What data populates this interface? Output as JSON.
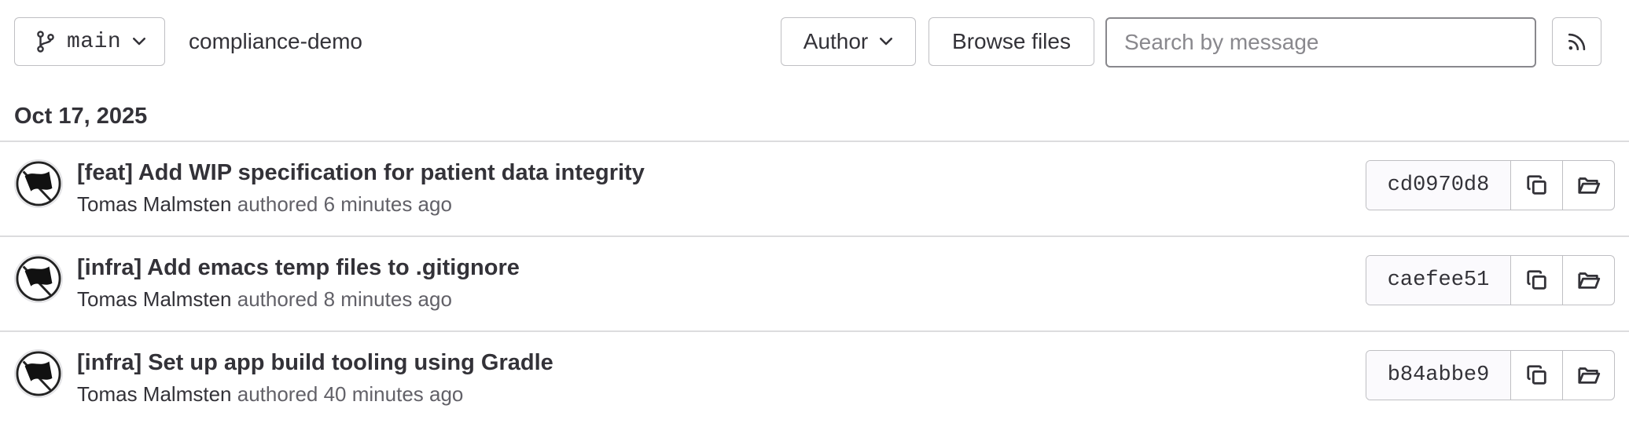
{
  "toolbar": {
    "branch_label": "main",
    "branch_icon": "branch-icon",
    "project_name": "compliance-demo",
    "author_label": "Author",
    "browse_files_label": "Browse files",
    "search_placeholder": "Search by message",
    "search_value": "",
    "rss_icon": "rss-icon"
  },
  "date_heading": "Oct 17, 2025",
  "commits": [
    {
      "title": "[feat] Add WIP specification for patient data integrity",
      "author": "Tomas Malmsten",
      "authored_text": "authored 6 minutes ago",
      "sha": "cd0970d8"
    },
    {
      "title": "[infra] Add emacs temp files to .gitignore",
      "author": "Tomas Malmsten",
      "authored_text": "authored 8 minutes ago",
      "sha": "caefee51"
    },
    {
      "title": "[infra] Set up app build tooling using Gradle",
      "author": "Tomas Malmsten",
      "authored_text": "authored 40 minutes ago",
      "sha": "b84abbe9"
    }
  ],
  "icons": {
    "copy": "copy-icon",
    "browse": "folder-open-icon",
    "chevron": "chevron-down-icon"
  },
  "colors": {
    "text": "#333238",
    "muted": "#626168",
    "border": "#bfbfc3",
    "divider": "#dcdcde"
  }
}
